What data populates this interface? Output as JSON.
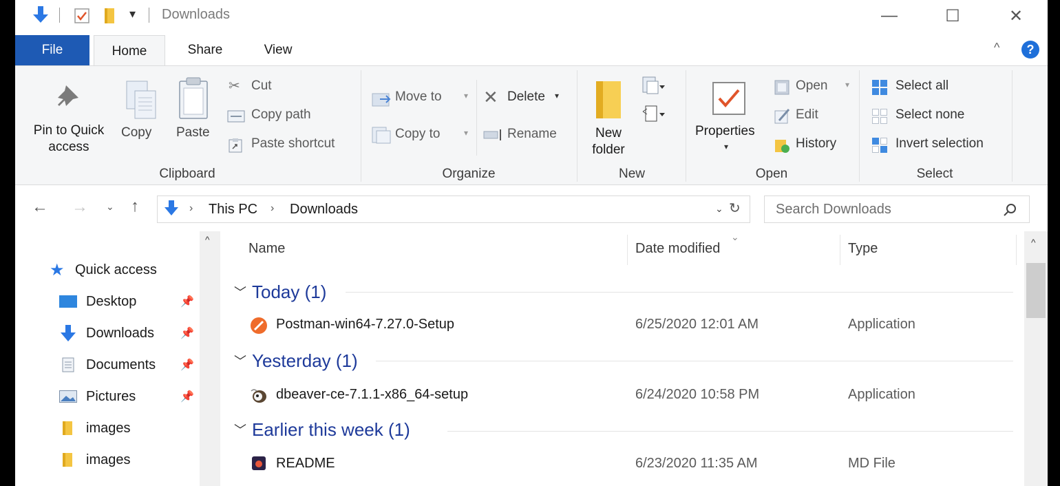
{
  "titlebar": {
    "title": "Downloads",
    "minimize": "—",
    "maximize": "☐",
    "close": "✕"
  },
  "tabs": [
    {
      "label": "File"
    },
    {
      "label": "Home"
    },
    {
      "label": "Share"
    },
    {
      "label": "View"
    }
  ],
  "ribbon": {
    "clipboard": {
      "label": "Clipboard",
      "pin_line1": "Pin to Quick",
      "pin_line2": "access",
      "copy": "Copy",
      "paste": "Paste",
      "cut": "Cut",
      "copy_path": "Copy path",
      "paste_shortcut": "Paste shortcut"
    },
    "organize": {
      "label": "Organize",
      "move_to": "Move to",
      "copy_to": "Copy to",
      "delete": "Delete",
      "rename": "Rename"
    },
    "new": {
      "label": "New",
      "new_folder_line1": "New",
      "new_folder_line2": "folder"
    },
    "open": {
      "label": "Open",
      "properties": "Properties",
      "open": "Open",
      "edit": "Edit",
      "history": "History"
    },
    "select": {
      "label": "Select",
      "select_all": "Select all",
      "select_none": "Select none",
      "invert_selection": "Invert selection"
    }
  },
  "address": {
    "crumbs": [
      "This PC",
      "Downloads"
    ],
    "search_placeholder": "Search Downloads"
  },
  "navpane": {
    "items": [
      {
        "label": "Quick access",
        "pinned": false
      },
      {
        "label": "Desktop",
        "pinned": true
      },
      {
        "label": "Downloads",
        "pinned": true
      },
      {
        "label": "Documents",
        "pinned": true
      },
      {
        "label": "Pictures",
        "pinned": true
      },
      {
        "label": "images",
        "pinned": false
      },
      {
        "label": "images",
        "pinned": false
      }
    ]
  },
  "filelist": {
    "columns": {
      "name": "Name",
      "date": "Date modified",
      "type": "Type"
    },
    "groups": [
      {
        "title": "Today (1)",
        "files": [
          {
            "name": "Postman-win64-7.27.0-Setup",
            "date": "6/25/2020 12:01 AM",
            "type": "Application"
          }
        ]
      },
      {
        "title": "Yesterday (1)",
        "files": [
          {
            "name": "dbeaver-ce-7.1.1-x86_64-setup",
            "date": "6/24/2020 10:58 PM",
            "type": "Application"
          }
        ]
      },
      {
        "title": "Earlier this week (1)",
        "files": [
          {
            "name": "README",
            "date": "6/23/2020 11:35 AM",
            "type": "MD File"
          }
        ]
      }
    ]
  },
  "colors": {
    "file_tab": "#1e5ab4",
    "group_header": "#1e3a9a",
    "accent_blue": "#2b78e4"
  }
}
